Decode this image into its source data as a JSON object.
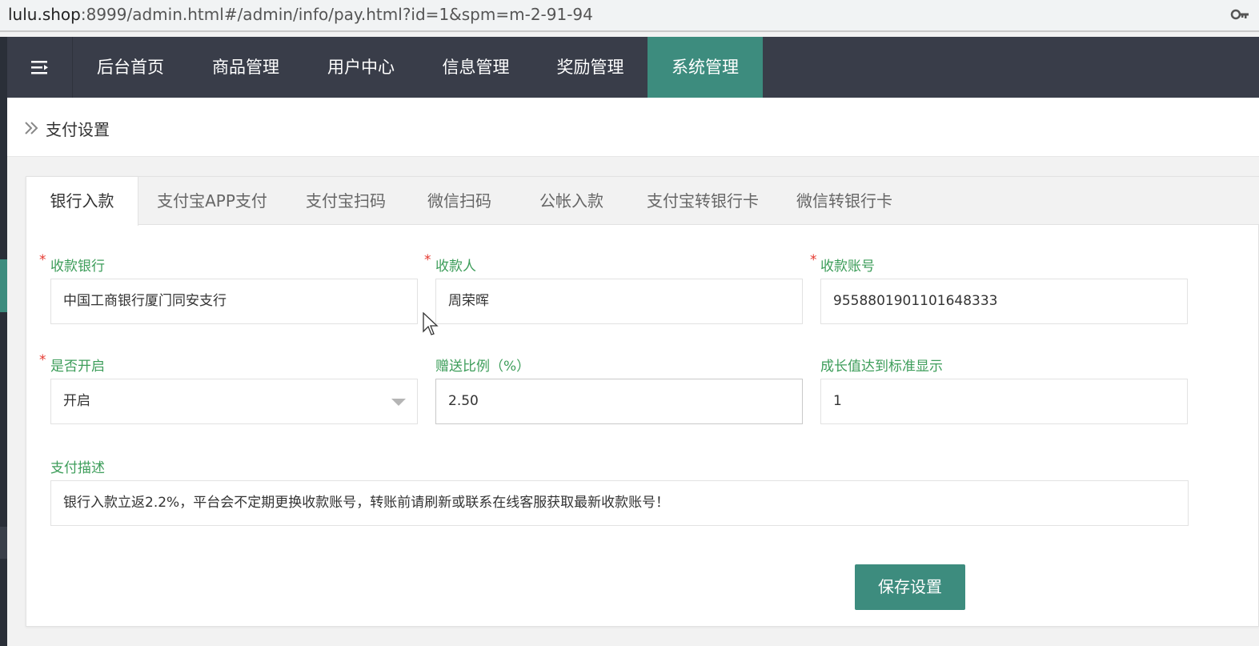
{
  "browser": {
    "url_host": "lulu.shop",
    "url_rest": ":8999/admin.html#/admin/info/pay.html?id=1&spm=m-2-91-94",
    "key_icon": "key-icon"
  },
  "nav": {
    "menu_icon": "menu-toggle-icon",
    "items": [
      {
        "label": "后台首页"
      },
      {
        "label": "商品管理"
      },
      {
        "label": "用户中心"
      },
      {
        "label": "信息管理"
      },
      {
        "label": "奖励管理"
      },
      {
        "label": "系统管理",
        "active": true
      }
    ],
    "accent": "#3d8c7e",
    "bg": "#393d49"
  },
  "breadcrumb": {
    "icon": "double-chevron-right-icon",
    "title": "支付设置"
  },
  "tabs": [
    {
      "label": "银行入款",
      "active": true
    },
    {
      "label": "支付宝APP支付"
    },
    {
      "label": "支付宝扫码"
    },
    {
      "label": "微信扫码"
    },
    {
      "label": "公帐入款"
    },
    {
      "label": "支付宝转银行卡"
    },
    {
      "label": "微信转银行卡"
    }
  ],
  "form": {
    "bank": {
      "label": "收款银行",
      "required": true,
      "value": "中国工商银行厦门同安支行"
    },
    "payee": {
      "label": "收款人",
      "required": true,
      "value": "周荣晖"
    },
    "account": {
      "label": "收款账号",
      "required": true,
      "value": "9558801901101648333"
    },
    "enabled": {
      "label": "是否开启",
      "required": true,
      "value": "开启"
    },
    "bonus_ratio": {
      "label": "赠送比例（%）",
      "value": "2.50"
    },
    "growth_display": {
      "label": "成长值达到标准显示",
      "value": "1"
    },
    "description": {
      "label": "支付描述",
      "value": "银行入款立返2.2%，平台会不定期更换收款账号，转账前请刷新或联系在线客服获取最新收款账号！"
    },
    "required_mark": "*",
    "save_label": "保存设置"
  }
}
